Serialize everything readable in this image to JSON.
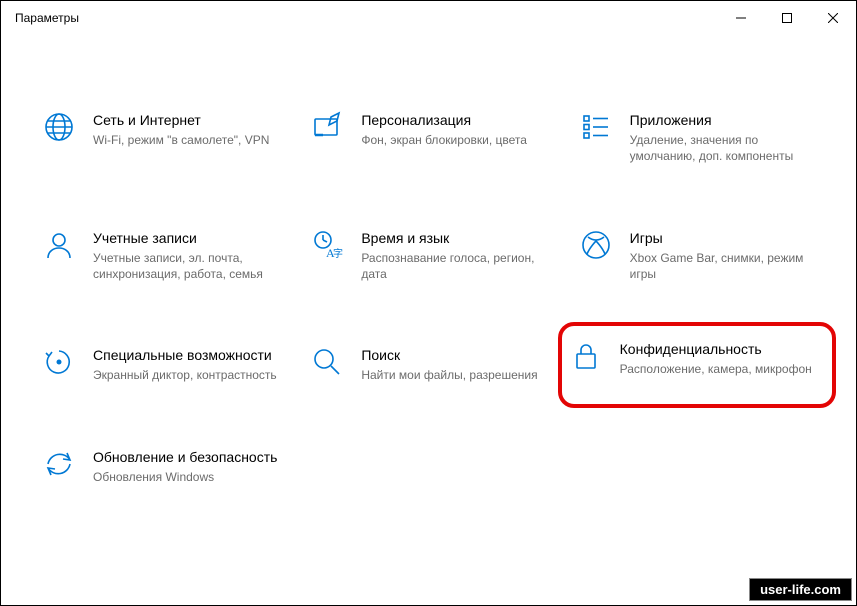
{
  "window": {
    "title": "Параметры"
  },
  "tiles": {
    "network": {
      "title": "Сеть и Интернет",
      "desc": "Wi-Fi, режим \"в самолете\", VPN"
    },
    "personalization": {
      "title": "Персонализация",
      "desc": "Фон, экран блокировки, цвета"
    },
    "apps": {
      "title": "Приложения",
      "desc": "Удаление, значения по умолчанию, доп. компоненты"
    },
    "accounts": {
      "title": "Учетные записи",
      "desc": "Учетные записи, эл. почта, синхронизация, работа, семья"
    },
    "time": {
      "title": "Время и язык",
      "desc": "Распознавание голоса, регион, дата"
    },
    "gaming": {
      "title": "Игры",
      "desc": "Xbox Game Bar, снимки, режим игры"
    },
    "ease": {
      "title": "Специальные возможности",
      "desc": "Экранный диктор, контрастность"
    },
    "search": {
      "title": "Поиск",
      "desc": "Найти мои файлы, разрешения"
    },
    "privacy": {
      "title": "Конфиденциальность",
      "desc": "Расположение, камера, микрофон"
    },
    "update": {
      "title": "Обновление и безопасность",
      "desc": "Обновления Windows"
    }
  },
  "watermark": "user-life.com"
}
